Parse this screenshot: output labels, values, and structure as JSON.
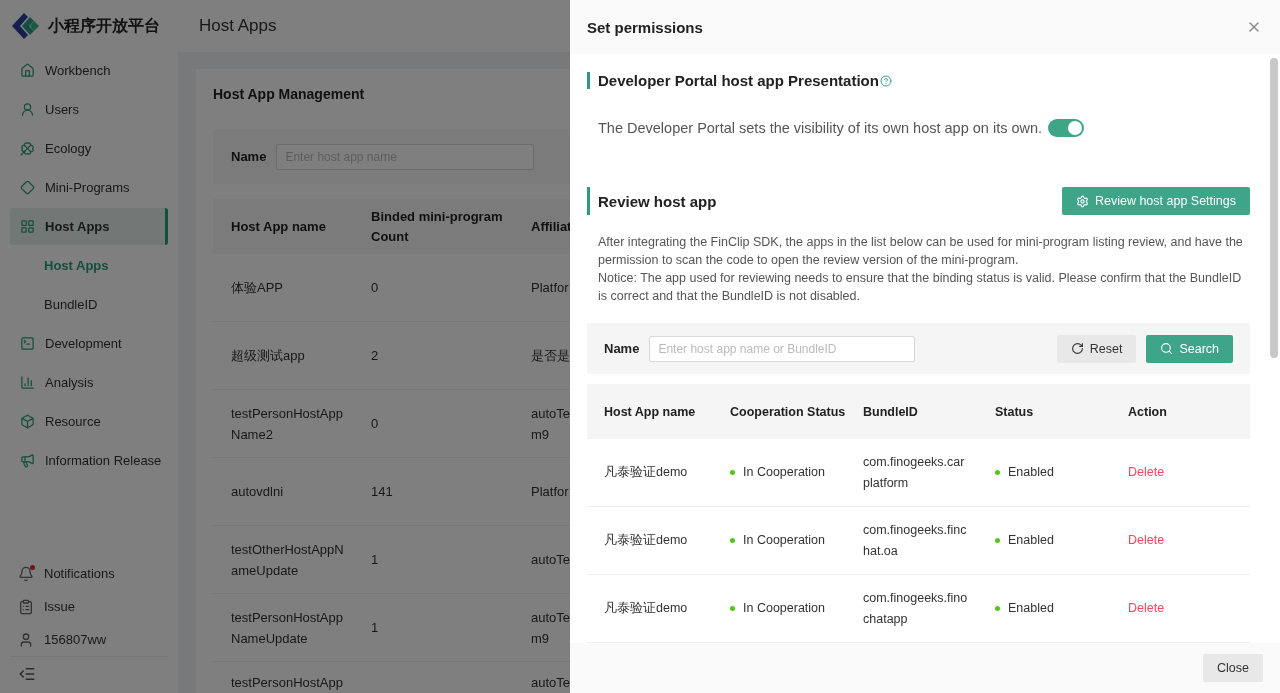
{
  "logo": {
    "text": "小程序开放平台"
  },
  "sidebar": {
    "items": [
      {
        "label": "Workbench",
        "selected": false
      },
      {
        "label": "Users",
        "selected": false
      },
      {
        "label": "Ecology",
        "selected": false
      },
      {
        "label": "Mini-Programs",
        "selected": false
      },
      {
        "label": "Host Apps",
        "selected": true,
        "children": [
          {
            "label": "Host Apps",
            "selected": true
          },
          {
            "label": "BundleID",
            "selected": false
          }
        ]
      },
      {
        "label": "Development",
        "selected": false
      },
      {
        "label": "Analysis",
        "selected": false
      },
      {
        "label": "Resource",
        "selected": false
      },
      {
        "label": "Information Release",
        "selected": false
      }
    ],
    "bottom": [
      {
        "label": "Notifications",
        "unread": true
      },
      {
        "label": "Issue",
        "unread": false
      },
      {
        "label": "156807ww",
        "unread": false
      }
    ]
  },
  "main": {
    "title": "Host Apps",
    "card_title": "Host App Management",
    "filter": {
      "label": "Name",
      "placeholder": "Enter host app name"
    },
    "table": {
      "columns": [
        "Host App name",
        "Binded mini-program Count",
        "Affiliat"
      ],
      "rows": [
        [
          "体验APP",
          "0",
          "Platfor"
        ],
        [
          "超级测试app",
          "2",
          "是否是"
        ],
        [
          "testPersonHostApp\nName2",
          "0",
          "autoTe\nm9"
        ],
        [
          "autovdlni",
          "141",
          "Platfor"
        ],
        [
          "testOtherHostAppN\nameUpdate",
          "1",
          "autoTe"
        ],
        [
          "testPersonHostApp\nNameUpdate",
          "1",
          "autoTe\nm9"
        ],
        [
          "testPersonHostApp",
          "",
          "autoTe"
        ]
      ]
    }
  },
  "drawer": {
    "title": "Set permissions",
    "presentation": {
      "heading": "Developer Portal host app Presentation",
      "text": "The Developer Portal sets the visibility of its own host app on its own.",
      "on": true
    },
    "review": {
      "heading": "Review host app",
      "settings_button": "Review host app Settings",
      "description": [
        "After integrating the FinClip SDK, the apps in the list below can be used for mini-program listing review, and have the permission to scan the code to open the review version of the mini-program.",
        "Notice: The app used for reviewing needs to ensure that the binding status is valid. Please confirm that the BundleID is correct and that the BundleID is not disabled."
      ],
      "filter": {
        "label": "Name",
        "placeholder": "Enter host app name or BundleID",
        "reset": "Reset",
        "search": "Search"
      },
      "columns": [
        "Host App name",
        "Cooperation Status",
        "BundleID",
        "Status",
        "Action"
      ],
      "rows": [
        {
          "name": "凡泰验证demo",
          "cooperation": {
            "text": "In Cooperation",
            "color": "#52c41a"
          },
          "bundle_id": "com.finogeeks.car\nplatform",
          "status": {
            "text": "Enabled",
            "color": "#52c41a"
          },
          "action": "Delete"
        },
        {
          "name": "凡泰验证demo",
          "cooperation": {
            "text": "In Cooperation",
            "color": "#52c41a"
          },
          "bundle_id": "com.finogeeks.finc\nhat.oa",
          "status": {
            "text": "Enabled",
            "color": "#52c41a"
          },
          "action": "Delete"
        },
        {
          "name": "凡泰验证demo",
          "cooperation": {
            "text": "In Cooperation",
            "color": "#52c41a"
          },
          "bundle_id": "com.finogeeks.fino\nchatapp",
          "status": {
            "text": "Enabled",
            "color": "#52c41a"
          },
          "action": "Delete"
        }
      ]
    },
    "close_button": "Close"
  }
}
